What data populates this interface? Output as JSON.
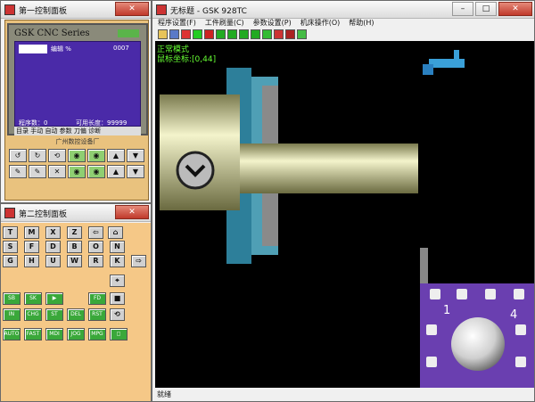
{
  "panel1": {
    "title": "第一控制面板",
    "crt_brand": "GSK CNC Series",
    "screen": {
      "tab": "程序目录",
      "mode": "编辑 %",
      "code": "0007",
      "program_count_label": "程序数：0",
      "available_length_label": "可用长度：99999"
    },
    "soft_keys": "目录 手动 自动 参数 刀偏 诊断",
    "maker": "广州数控设备厂"
  },
  "panel2": {
    "title": "第二控制面板",
    "keys": [
      "T",
      "M",
      "X",
      "Z",
      "S",
      "F",
      "D",
      "B",
      "O",
      "N",
      "G",
      "H",
      "U",
      "W",
      "R",
      "K"
    ]
  },
  "main": {
    "title": "无标题 - GSK 928TC",
    "menu": [
      "程序设置(F)",
      "工件刷量(C)",
      "参数设置(P)",
      "机床操作(O)",
      "帮助(H)"
    ],
    "mode_text": "正常模式",
    "coord_text": "鼠标坐标:[0,44]",
    "status": "就绪",
    "turret_labels": [
      "1",
      "4"
    ]
  },
  "colors": {
    "accent_green": "#66ff33",
    "crt_blue": "#4a2aa8",
    "panel_orange": "#f5c887",
    "turret_purple": "#6a3fb0"
  }
}
